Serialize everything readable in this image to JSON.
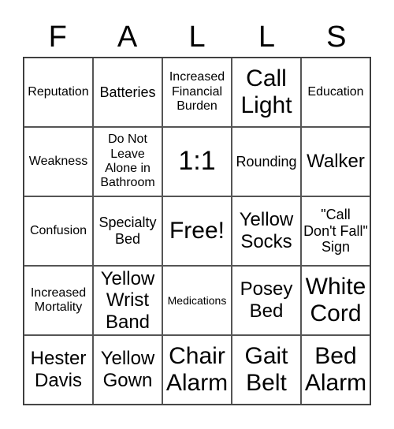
{
  "title_letters": [
    "F",
    "A",
    "L",
    "L",
    "S"
  ],
  "cells": [
    "Reputation",
    "Batteries",
    "Increased Financial Burden",
    "Call Light",
    "Education",
    "Weakness",
    "Do Not Leave Alone in Bathroom",
    "1:1",
    "Rounding",
    "Walker",
    "Confusion",
    "Specialty Bed",
    "Free!",
    "Yellow Socks",
    "\"Call Don't Fall\" Sign",
    "Increased Mortality",
    "Yellow Wrist Band",
    "Medications",
    "Posey Bed",
    "White Cord",
    "Hester Davis",
    "Yellow Gown",
    "Chair Alarm",
    "Gait Belt",
    "Bed Alarm"
  ]
}
